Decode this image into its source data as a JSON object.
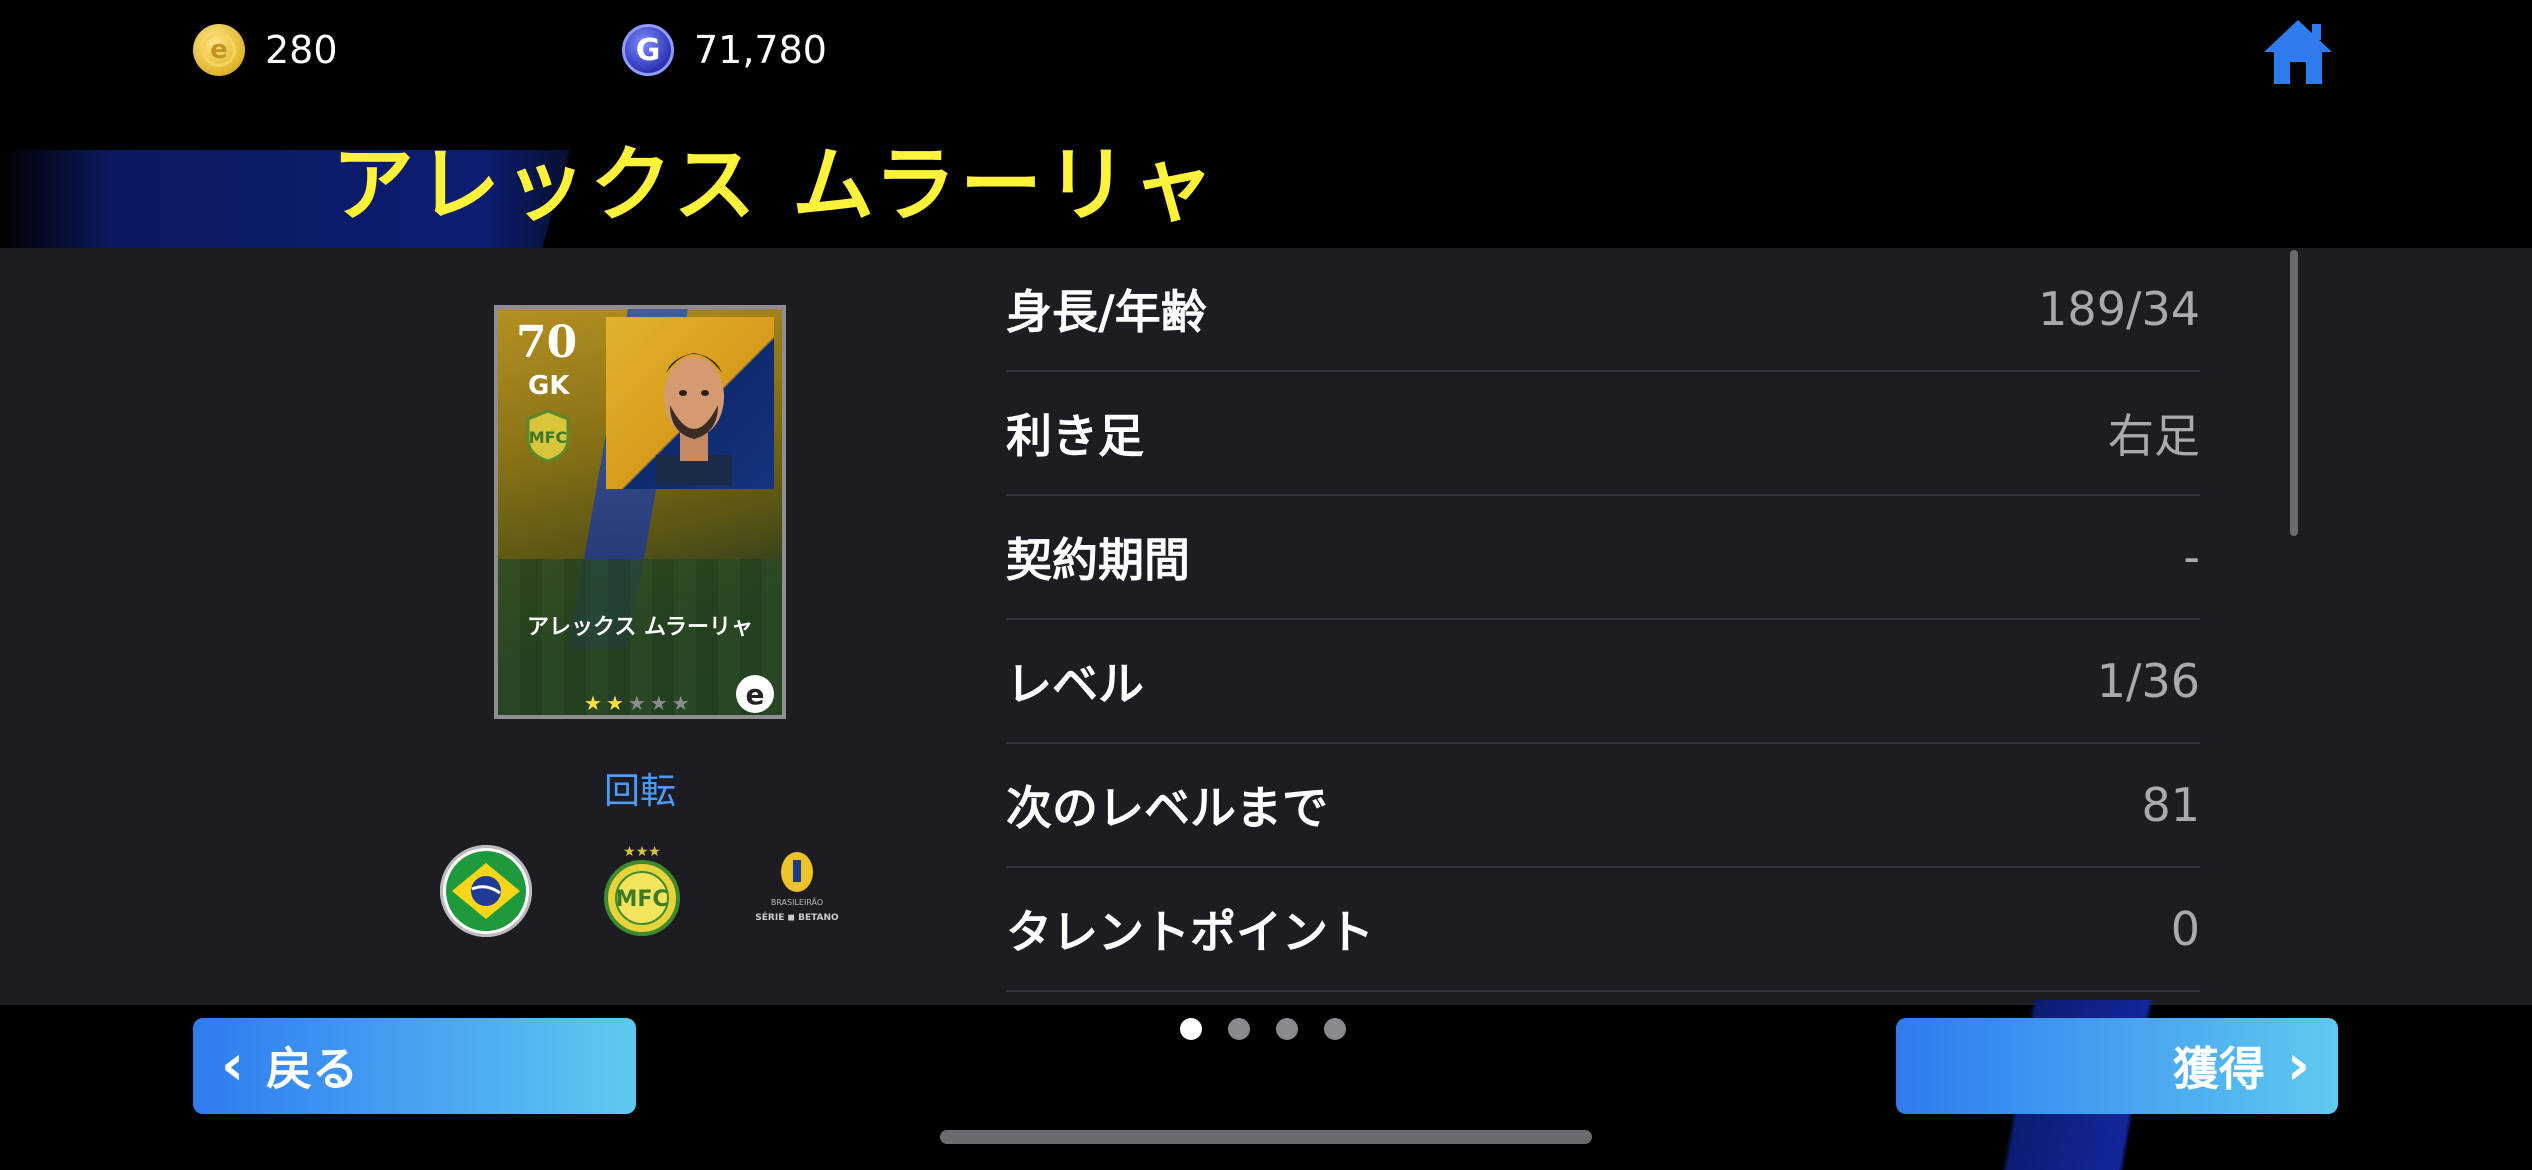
{
  "header": {
    "coins": "280",
    "gp": "71,780"
  },
  "player": {
    "name": "アレックス ムラーリャ"
  },
  "card": {
    "rating": "70",
    "position": "GK",
    "name": "アレックス ムラーリャ",
    "stars_filled": 2,
    "stars_total": 5
  },
  "rotate_label": "回転",
  "stats": [
    {
      "label": "身長/年齢",
      "value": "189/34"
    },
    {
      "label": "利き足",
      "value": "右足"
    },
    {
      "label": "契約期間",
      "value": "-"
    },
    {
      "label": "レベル",
      "value": "1/36"
    },
    {
      "label": "次のレベルまで",
      "value": "81"
    },
    {
      "label": "タレントポイント",
      "value": "0"
    }
  ],
  "buttons": {
    "back": "戻る",
    "acquire": "獲得"
  },
  "pager": {
    "pages": 4,
    "current": 1
  },
  "colors": {
    "title_yellow": "#fff23a",
    "accent_blue": "#4a9cf7",
    "panel_bg": "#1c1c22"
  },
  "icons": [
    "coin-icon",
    "gp-coin-icon",
    "home-icon",
    "chevron-left-icon",
    "chevron-right-icon",
    "nationality-flag-icon",
    "club-crest-icon",
    "league-badge-icon"
  ]
}
